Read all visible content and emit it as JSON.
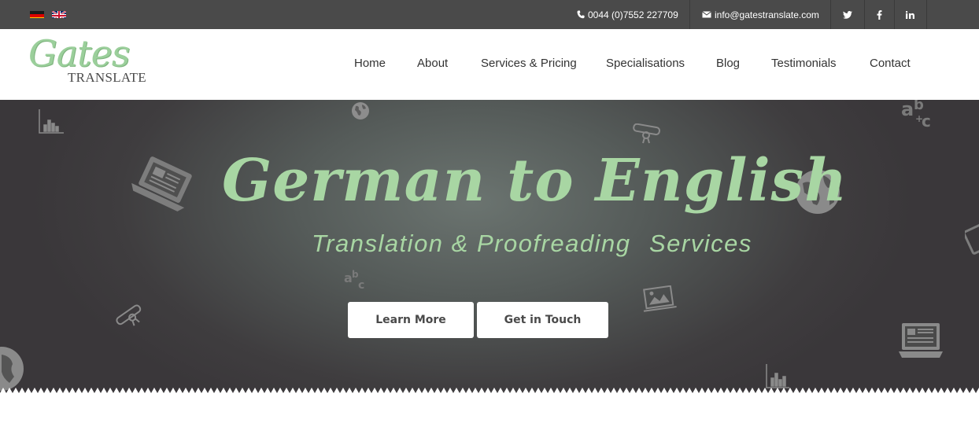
{
  "topbar": {
    "languages": [
      {
        "name": "German",
        "icon": "germany-flag-icon"
      },
      {
        "name": "English",
        "icon": "uk-flag-icon"
      }
    ],
    "phone": "0044 (0)7552 227709",
    "email": "info@gatestranslate.com",
    "social": [
      "twitter-icon",
      "facebook-icon",
      "linkedin-icon"
    ]
  },
  "logo": {
    "script": "Gates",
    "caps": "TRANSLATE"
  },
  "nav": {
    "items": [
      {
        "label": "Home"
      },
      {
        "label": "About"
      },
      {
        "label": "Services & Pricing"
      },
      {
        "label": "Specialisations"
      },
      {
        "label": "Blog"
      },
      {
        "label": "Testimonials"
      },
      {
        "label": "Contact"
      }
    ]
  },
  "hero": {
    "title": "German to English",
    "subtitle_left": "Translation & Proofreading",
    "subtitle_right": "Services",
    "learn_more": "Learn More",
    "get_in_touch": "Get in Touch",
    "decor_icons": [
      "bar-chart-icon",
      "globe-icon",
      "diploma-icon",
      "abc-icon",
      "laptop-icon",
      "picture-icon"
    ]
  },
  "colors": {
    "topbar": "#4a4a4a",
    "accent_green": "#a8d6a3",
    "hero_dark": "#3a373a",
    "hero_light": "#6b7470"
  }
}
